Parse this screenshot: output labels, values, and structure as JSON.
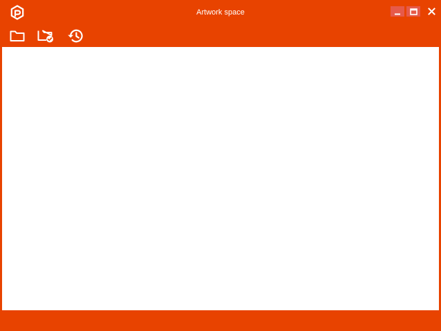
{
  "window": {
    "title": "Artwork space",
    "accent_color": "#e84300",
    "control_highlight_color": "#e65a4a"
  },
  "titlebar": {
    "logo_icon": "app-logo-icon",
    "controls": {
      "minimize_icon": "minimize-icon",
      "maximize_icon": "maximize-icon",
      "close_icon": "close-icon"
    }
  },
  "toolbar": {
    "tools": [
      {
        "id": "open",
        "icon": "folder-icon"
      },
      {
        "id": "open-verified",
        "icon": "folder-check-icon"
      },
      {
        "id": "history",
        "icon": "history-icon"
      }
    ]
  }
}
